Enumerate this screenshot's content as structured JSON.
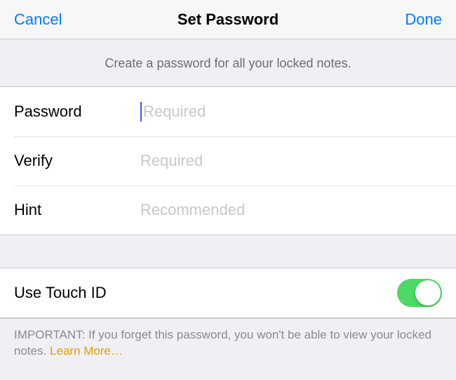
{
  "nav": {
    "cancel": "Cancel",
    "title": "Set Password",
    "done": "Done"
  },
  "header": {
    "subtitle": "Create a password for all your locked notes."
  },
  "fields": {
    "password": {
      "label": "Password",
      "placeholder": "Required",
      "value": ""
    },
    "verify": {
      "label": "Verify",
      "placeholder": "Required",
      "value": ""
    },
    "hint": {
      "label": "Hint",
      "placeholder": "Recommended",
      "value": ""
    }
  },
  "touchid": {
    "label": "Use Touch ID",
    "enabled": true
  },
  "footer": {
    "text": "IMPORTANT: If you forget this password, you won't be able to view your locked notes. ",
    "link": "Learn More…"
  },
  "colors": {
    "tint": "#007aff",
    "switchOn": "#4cd964",
    "link": "#e6a100"
  }
}
